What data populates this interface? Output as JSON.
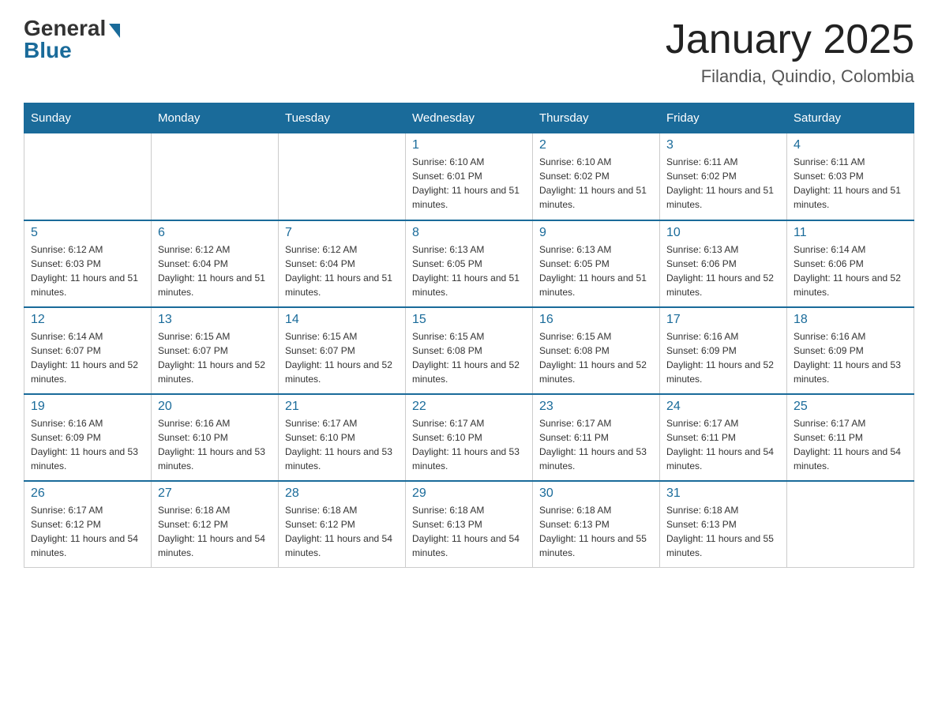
{
  "logo": {
    "general": "General",
    "blue": "Blue"
  },
  "title": "January 2025",
  "location": "Filandia, Quindio, Colombia",
  "days_of_week": [
    "Sunday",
    "Monday",
    "Tuesday",
    "Wednesday",
    "Thursday",
    "Friday",
    "Saturday"
  ],
  "weeks": [
    [
      {
        "day": "",
        "info": ""
      },
      {
        "day": "",
        "info": ""
      },
      {
        "day": "",
        "info": ""
      },
      {
        "day": "1",
        "info": "Sunrise: 6:10 AM\nSunset: 6:01 PM\nDaylight: 11 hours and 51 minutes."
      },
      {
        "day": "2",
        "info": "Sunrise: 6:10 AM\nSunset: 6:02 PM\nDaylight: 11 hours and 51 minutes."
      },
      {
        "day": "3",
        "info": "Sunrise: 6:11 AM\nSunset: 6:02 PM\nDaylight: 11 hours and 51 minutes."
      },
      {
        "day": "4",
        "info": "Sunrise: 6:11 AM\nSunset: 6:03 PM\nDaylight: 11 hours and 51 minutes."
      }
    ],
    [
      {
        "day": "5",
        "info": "Sunrise: 6:12 AM\nSunset: 6:03 PM\nDaylight: 11 hours and 51 minutes."
      },
      {
        "day": "6",
        "info": "Sunrise: 6:12 AM\nSunset: 6:04 PM\nDaylight: 11 hours and 51 minutes."
      },
      {
        "day": "7",
        "info": "Sunrise: 6:12 AM\nSunset: 6:04 PM\nDaylight: 11 hours and 51 minutes."
      },
      {
        "day": "8",
        "info": "Sunrise: 6:13 AM\nSunset: 6:05 PM\nDaylight: 11 hours and 51 minutes."
      },
      {
        "day": "9",
        "info": "Sunrise: 6:13 AM\nSunset: 6:05 PM\nDaylight: 11 hours and 51 minutes."
      },
      {
        "day": "10",
        "info": "Sunrise: 6:13 AM\nSunset: 6:06 PM\nDaylight: 11 hours and 52 minutes."
      },
      {
        "day": "11",
        "info": "Sunrise: 6:14 AM\nSunset: 6:06 PM\nDaylight: 11 hours and 52 minutes."
      }
    ],
    [
      {
        "day": "12",
        "info": "Sunrise: 6:14 AM\nSunset: 6:07 PM\nDaylight: 11 hours and 52 minutes."
      },
      {
        "day": "13",
        "info": "Sunrise: 6:15 AM\nSunset: 6:07 PM\nDaylight: 11 hours and 52 minutes."
      },
      {
        "day": "14",
        "info": "Sunrise: 6:15 AM\nSunset: 6:07 PM\nDaylight: 11 hours and 52 minutes."
      },
      {
        "day": "15",
        "info": "Sunrise: 6:15 AM\nSunset: 6:08 PM\nDaylight: 11 hours and 52 minutes."
      },
      {
        "day": "16",
        "info": "Sunrise: 6:15 AM\nSunset: 6:08 PM\nDaylight: 11 hours and 52 minutes."
      },
      {
        "day": "17",
        "info": "Sunrise: 6:16 AM\nSunset: 6:09 PM\nDaylight: 11 hours and 52 minutes."
      },
      {
        "day": "18",
        "info": "Sunrise: 6:16 AM\nSunset: 6:09 PM\nDaylight: 11 hours and 53 minutes."
      }
    ],
    [
      {
        "day": "19",
        "info": "Sunrise: 6:16 AM\nSunset: 6:09 PM\nDaylight: 11 hours and 53 minutes."
      },
      {
        "day": "20",
        "info": "Sunrise: 6:16 AM\nSunset: 6:10 PM\nDaylight: 11 hours and 53 minutes."
      },
      {
        "day": "21",
        "info": "Sunrise: 6:17 AM\nSunset: 6:10 PM\nDaylight: 11 hours and 53 minutes."
      },
      {
        "day": "22",
        "info": "Sunrise: 6:17 AM\nSunset: 6:10 PM\nDaylight: 11 hours and 53 minutes."
      },
      {
        "day": "23",
        "info": "Sunrise: 6:17 AM\nSunset: 6:11 PM\nDaylight: 11 hours and 53 minutes."
      },
      {
        "day": "24",
        "info": "Sunrise: 6:17 AM\nSunset: 6:11 PM\nDaylight: 11 hours and 54 minutes."
      },
      {
        "day": "25",
        "info": "Sunrise: 6:17 AM\nSunset: 6:11 PM\nDaylight: 11 hours and 54 minutes."
      }
    ],
    [
      {
        "day": "26",
        "info": "Sunrise: 6:17 AM\nSunset: 6:12 PM\nDaylight: 11 hours and 54 minutes."
      },
      {
        "day": "27",
        "info": "Sunrise: 6:18 AM\nSunset: 6:12 PM\nDaylight: 11 hours and 54 minutes."
      },
      {
        "day": "28",
        "info": "Sunrise: 6:18 AM\nSunset: 6:12 PM\nDaylight: 11 hours and 54 minutes."
      },
      {
        "day": "29",
        "info": "Sunrise: 6:18 AM\nSunset: 6:13 PM\nDaylight: 11 hours and 54 minutes."
      },
      {
        "day": "30",
        "info": "Sunrise: 6:18 AM\nSunset: 6:13 PM\nDaylight: 11 hours and 55 minutes."
      },
      {
        "day": "31",
        "info": "Sunrise: 6:18 AM\nSunset: 6:13 PM\nDaylight: 11 hours and 55 minutes."
      },
      {
        "day": "",
        "info": ""
      }
    ]
  ]
}
